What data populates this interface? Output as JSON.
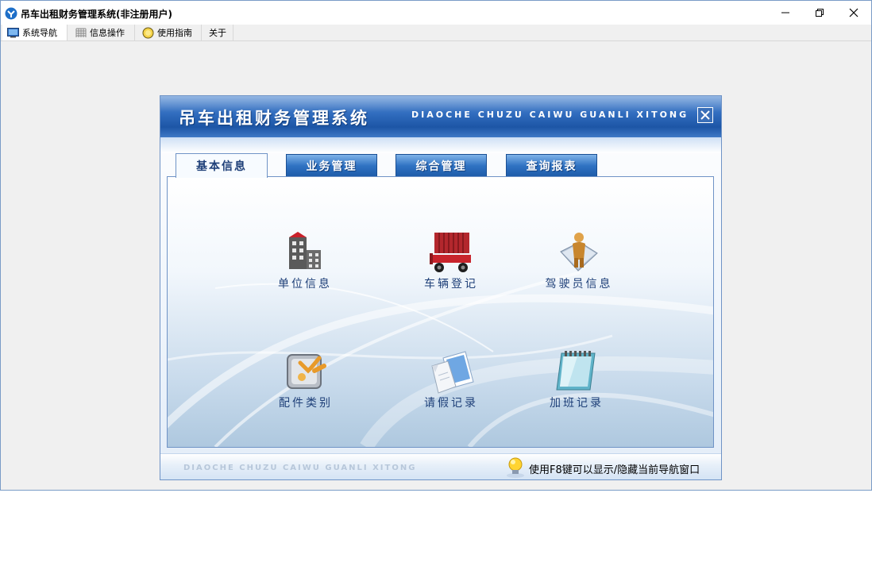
{
  "window": {
    "title": "吊车出租财务管理系统(非注册用户)"
  },
  "menubar": {
    "items": [
      {
        "label": "系统导航",
        "icon": "monitor-icon",
        "active": true
      },
      {
        "label": "信息操作",
        "icon": "grid-icon",
        "active": false
      },
      {
        "label": "使用指南",
        "icon": "help-badge-icon",
        "active": false
      },
      {
        "label": "关于",
        "icon": "",
        "active": false
      }
    ]
  },
  "nav": {
    "title": "吊车出租财务管理系统",
    "subtitle": "DIAOCHE CHUZU CAIWU GUANLI XITONG",
    "tabs": [
      {
        "label": "基本信息",
        "active": true
      },
      {
        "label": "业务管理",
        "active": false
      },
      {
        "label": "综合管理",
        "active": false
      },
      {
        "label": "查询报表",
        "active": false
      }
    ],
    "items": [
      {
        "label": "单位信息",
        "icon": "building-icon"
      },
      {
        "label": "车辆登记",
        "icon": "forklift-container-icon"
      },
      {
        "label": "驾驶员信息",
        "icon": "driver-person-icon"
      },
      {
        "label": "配件类别",
        "icon": "tools-wrench-icon"
      },
      {
        "label": "请假记录",
        "icon": "documents-icon"
      },
      {
        "label": "加班记录",
        "icon": "notepad-icon"
      }
    ],
    "footer": {
      "brand": "DIAOCHE CHUZU CAIWU GUANLI XITONG",
      "tip": "使用F8键可以显示/隐藏当前导航窗口"
    }
  },
  "colors": {
    "header_blue": "#2f6bbd",
    "tab_blue": "#2f72c2",
    "label_blue": "#1e3f78",
    "window_border": "#7a9cc7"
  }
}
